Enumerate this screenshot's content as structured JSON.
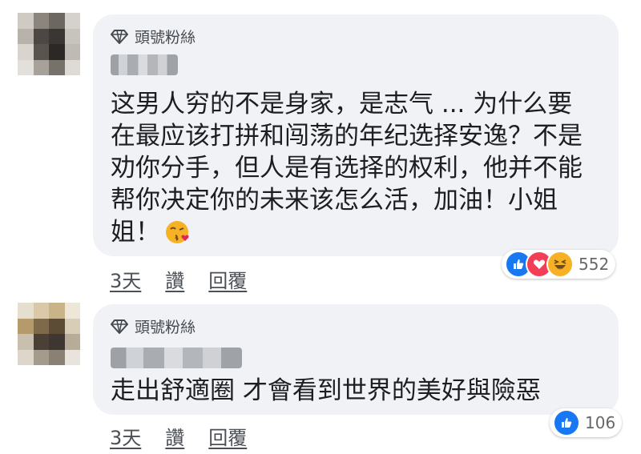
{
  "comments": [
    {
      "badge": "頭號粉絲",
      "text": "这男人穷的不是身家，是志气 ... 为什么要在最应该打拼和闯荡的年纪选择安逸？不是劝你分手，但人是有选择的权利，他并不能帮你决定你的未来该怎么活，加油！小姐姐！",
      "reactions": {
        "icons": [
          "like-icon",
          "love-icon",
          "haha-icon"
        ],
        "count": "552"
      },
      "time": "3天",
      "like_label": "讚",
      "reply_label": "回覆"
    },
    {
      "badge": "頭號粉絲",
      "text": "走出舒適圈 才會看到世界的美好與險惡",
      "reactions": {
        "icons": [
          "like-icon"
        ],
        "count": "106"
      },
      "time": "3天",
      "like_label": "讚",
      "reply_label": "回覆"
    }
  ],
  "colors": {
    "like": "#1877f2",
    "love": "#f33e58",
    "haha": "#f7b125",
    "bubble": "#f0f2f5"
  }
}
